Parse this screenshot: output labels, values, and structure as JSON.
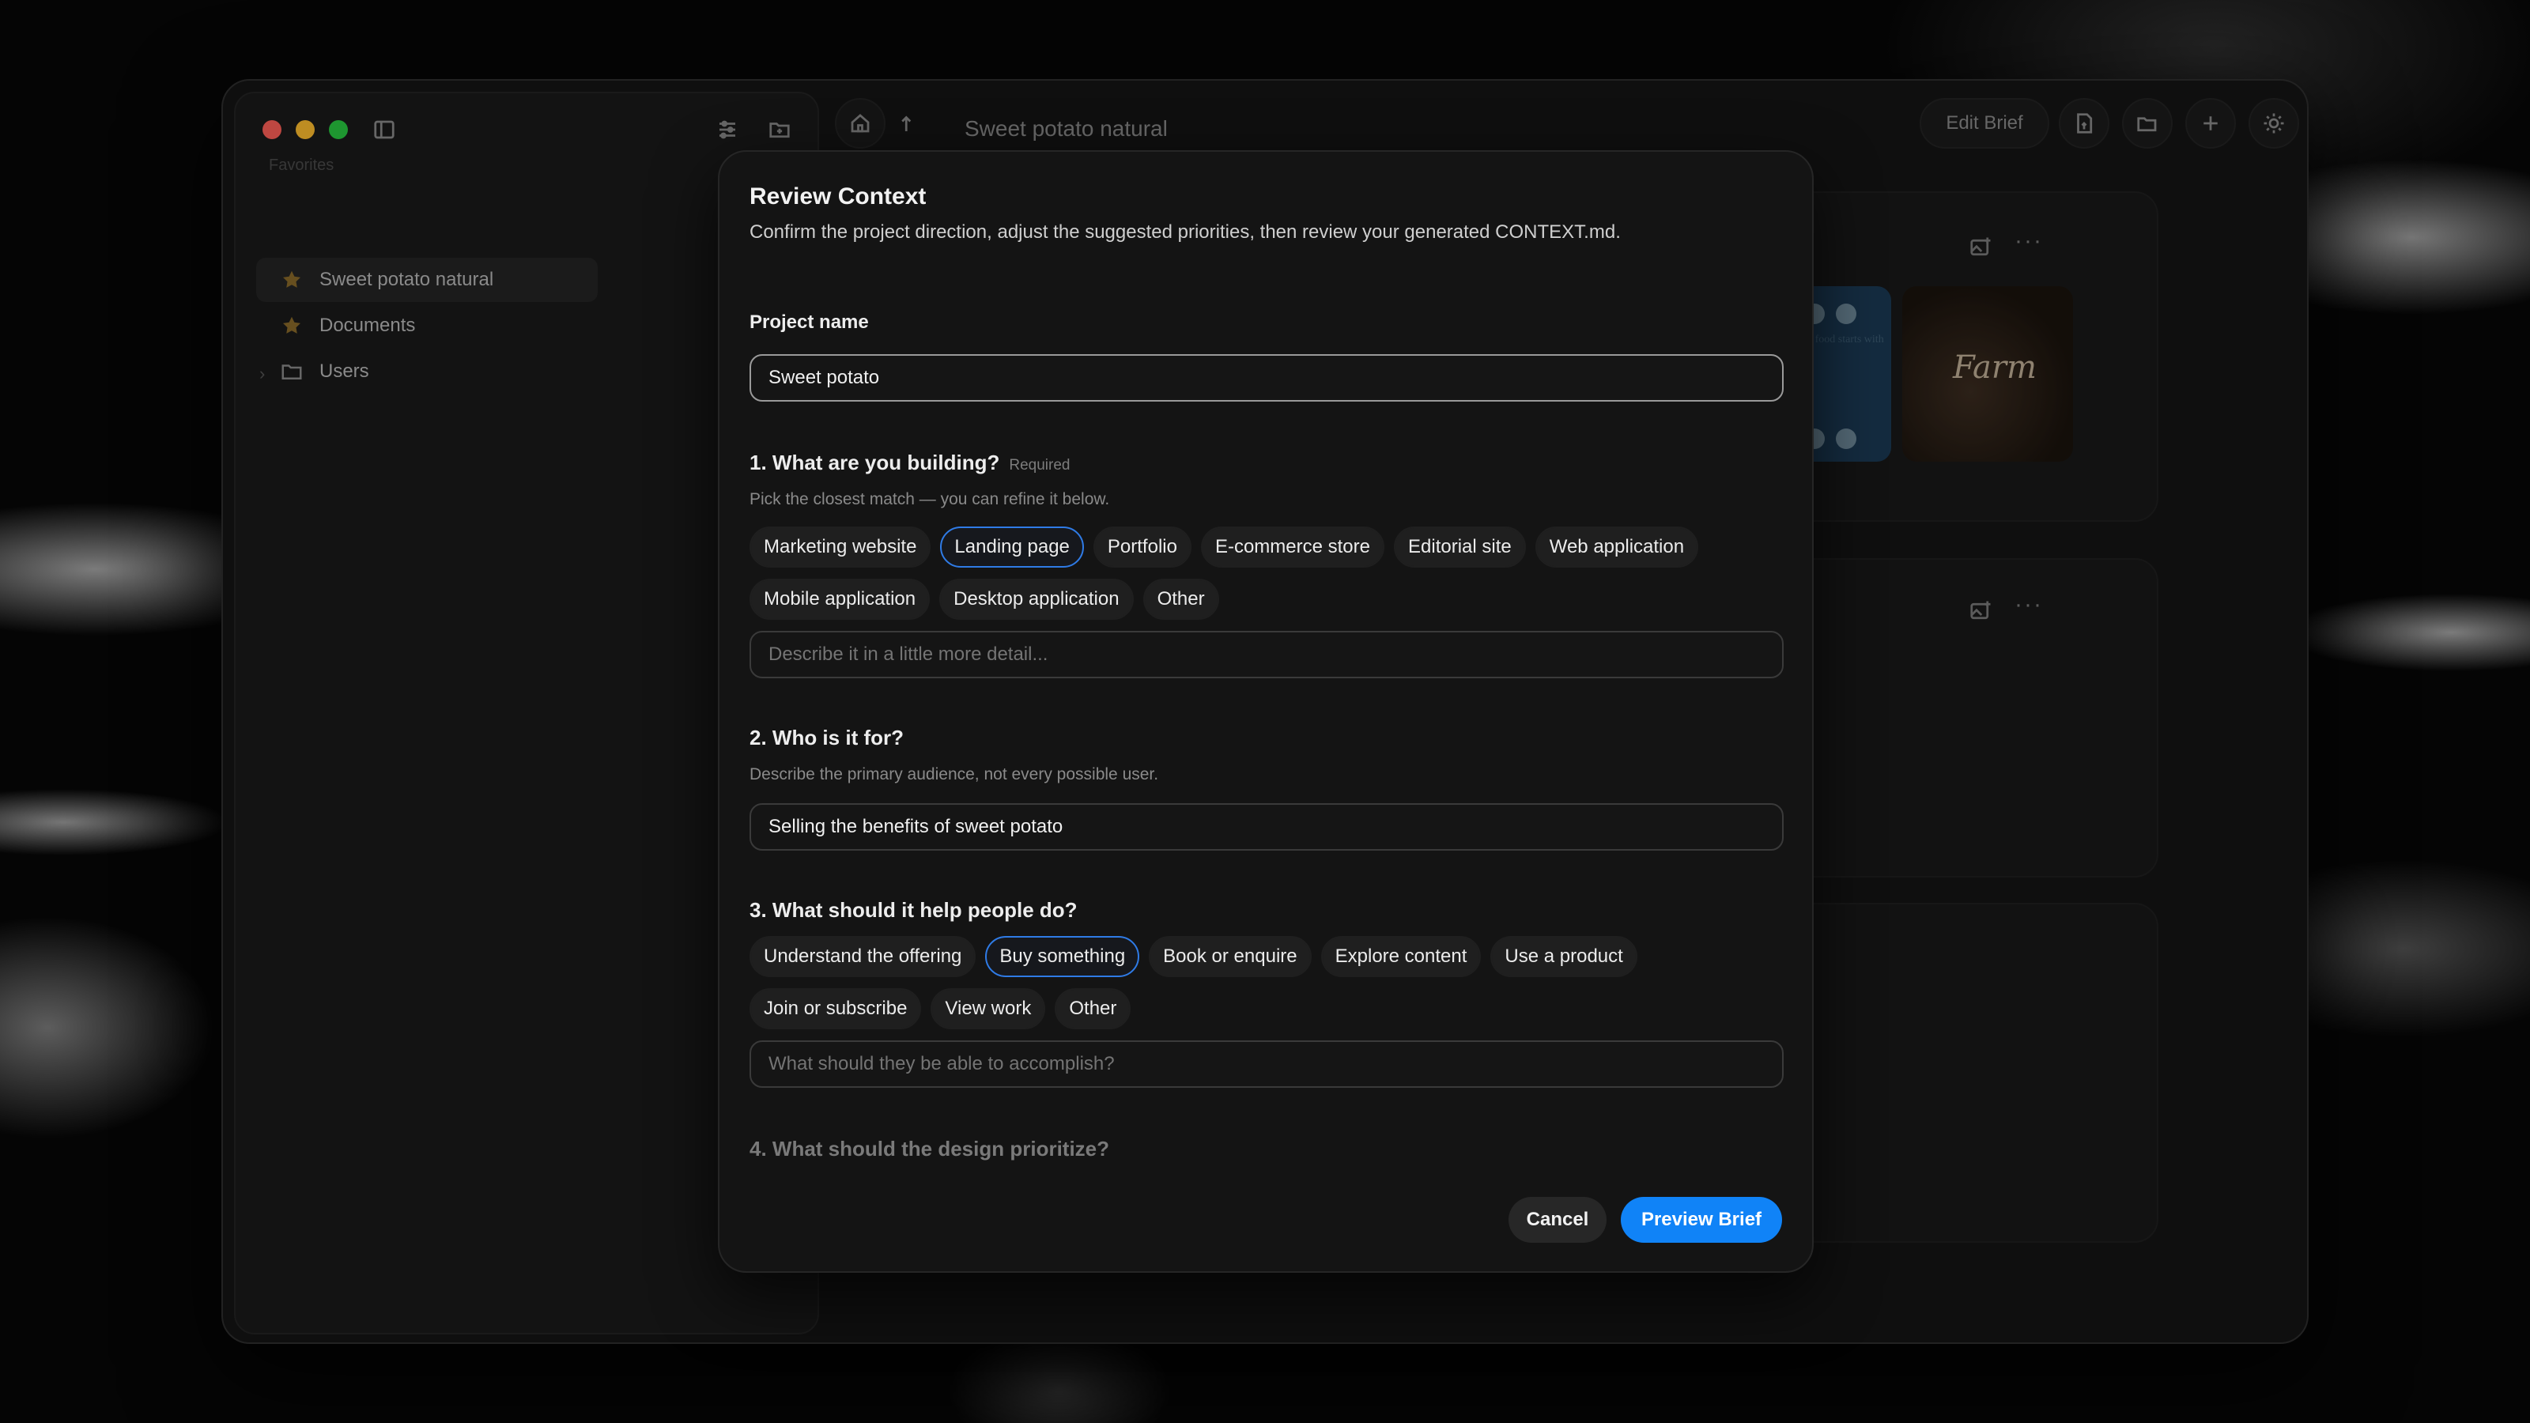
{
  "window": {
    "title": "Sweet potato natural",
    "header_buttons": {
      "edit_brief": "Edit Brief"
    }
  },
  "sidebar": {
    "section_label": "Favorites",
    "items": [
      {
        "label": "Sweet potato natural",
        "icon": "star-icon"
      },
      {
        "label": "Documents",
        "icon": "star-icon"
      },
      {
        "label": "Users",
        "icon": "folder-icon"
      }
    ]
  },
  "background_cards": {
    "thumb_text": "the Farm, we know food starts with how it's grown.",
    "thumb_logo": "Farm"
  },
  "modal": {
    "title": "Review Context",
    "subtitle": "Confirm the project direction, adjust the suggested priorities, then review your generated CONTEXT.md.",
    "project_name": {
      "label": "Project name",
      "value": "Sweet potato"
    },
    "q1": {
      "label": "1. What are you building?",
      "required": "Required",
      "hint": "Pick the closest match — you can refine it below.",
      "options_row1": [
        "Marketing website",
        "Landing page",
        "Portfolio",
        "E-commerce store",
        "Editorial site",
        "Web application"
      ],
      "options_row2": [
        "Mobile application",
        "Desktop application",
        "Other"
      ],
      "selected": "Landing page",
      "detail_placeholder": "Describe it in a little more detail..."
    },
    "q2": {
      "label": "2. Who is it for?",
      "hint": "Describe the primary audience, not every possible user.",
      "value": "Selling the benefits of sweet potato"
    },
    "q3": {
      "label": "3. What should it help people do?",
      "options_row1": [
        "Understand the offering",
        "Buy something",
        "Book or enquire",
        "Explore content",
        "Use a product"
      ],
      "options_row2": [
        "Join or subscribe",
        "View work",
        "Other"
      ],
      "selected": "Buy something",
      "detail_placeholder": "What should they be able to accomplish?"
    },
    "q4": {
      "label": "4. What should the design prioritize?"
    },
    "buttons": {
      "cancel": "Cancel",
      "preview": "Preview Brief"
    }
  },
  "colors": {
    "accent": "#1083f7",
    "selected_chip_border": "#2f7be6",
    "traffic_red": "#fe5f57",
    "traffic_yellow": "#febc2e",
    "traffic_green": "#28c840"
  }
}
